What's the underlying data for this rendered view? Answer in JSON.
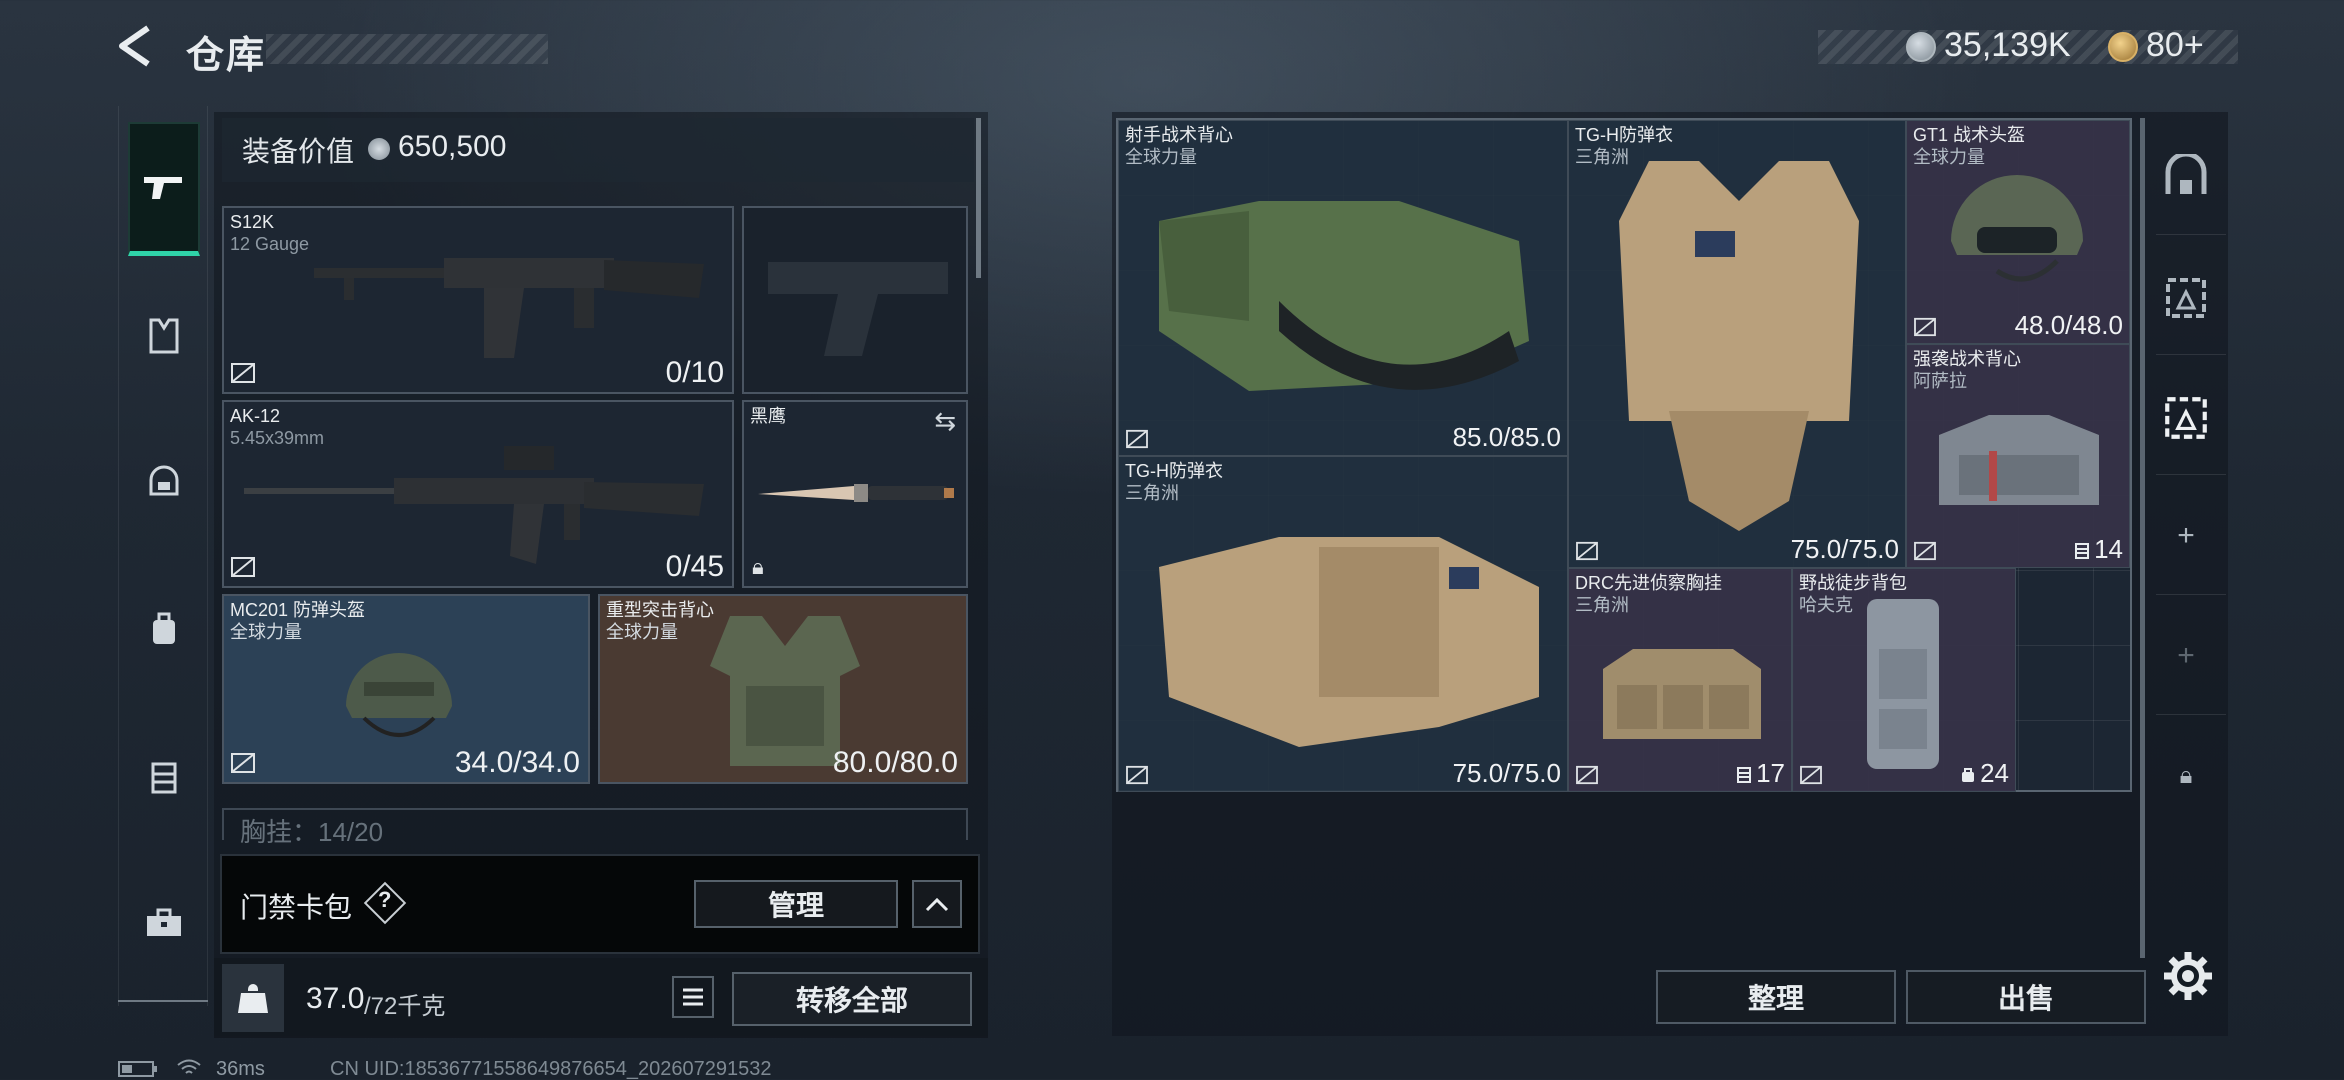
{
  "header": {
    "title": "仓库",
    "currency1": "35,139K",
    "currency2": "80+"
  },
  "left": {
    "equip_value_label": "装备价值",
    "equip_value": "650,500",
    "slots": [
      {
        "name": "S12K",
        "sub": "12 Gauge",
        "value": "0/10"
      },
      {
        "name": "",
        "sub": "",
        "value": ""
      },
      {
        "name": "AK-12",
        "sub": "5.45x39mm",
        "value": "0/45"
      },
      {
        "name": "黑鹰",
        "sub": "",
        "value": ""
      },
      {
        "name": "MC201 防弹头盔",
        "sub": "全球力量",
        "value": "34.0/34.0"
      },
      {
        "name": "重型突击背心",
        "sub": "全球力量",
        "value": "80.0/80.0"
      }
    ],
    "chest_rig": "胸挂：14/20",
    "keycard_label": "门禁卡包",
    "keycard_help": "?",
    "manage_button": "管理",
    "weight_current": "37.0",
    "weight_max": "/72千克",
    "transfer_button": "转移全部"
  },
  "storage": {
    "items": [
      {
        "name": "射手战术背心",
        "sub": "全球力量",
        "value": "85.0/85.0"
      },
      {
        "name": "TG-H防弹衣",
        "sub": "三角洲",
        "value": "75.0/75.0"
      },
      {
        "name": "GT1 战术头盔",
        "sub": "全球力量",
        "value": "48.0/48.0"
      },
      {
        "name": "强袭战术背心",
        "sub": "阿萨拉",
        "value": "14"
      },
      {
        "name": "TG-H防弹衣",
        "sub": "三角洲",
        "value": "75.0/75.0"
      },
      {
        "name": "DRC先进侦察胸挂",
        "sub": "三角洲",
        "value": "17"
      },
      {
        "name": "野战徒步背包",
        "sub": "哈夫克",
        "value": "24"
      }
    ],
    "sort_button": "整理",
    "sell_button": "出售"
  },
  "status": {
    "ping": "36ms",
    "uid": "CN UID:1853677155864987665​4_202607291532"
  },
  "colors": {
    "accent_green": "#2fd3a8",
    "panel_dark": "#1d2632",
    "purple_cell": "#363148",
    "brown_cell": "#4a3a32"
  },
  "icons": [
    "back-arrow-icon",
    "coin-icon",
    "gold-coin-icon",
    "pistol-icon",
    "armor-vest-icon",
    "helmet-icon",
    "backpack-icon",
    "chest-rig-icon",
    "toolbox-icon",
    "swap-icon",
    "lock-icon",
    "no-insure-icon",
    "weight-icon",
    "list-icon",
    "chevron-up-icon",
    "storage-icon",
    "add-icon",
    "settings-icon",
    "battery-icon",
    "wifi-icon"
  ]
}
